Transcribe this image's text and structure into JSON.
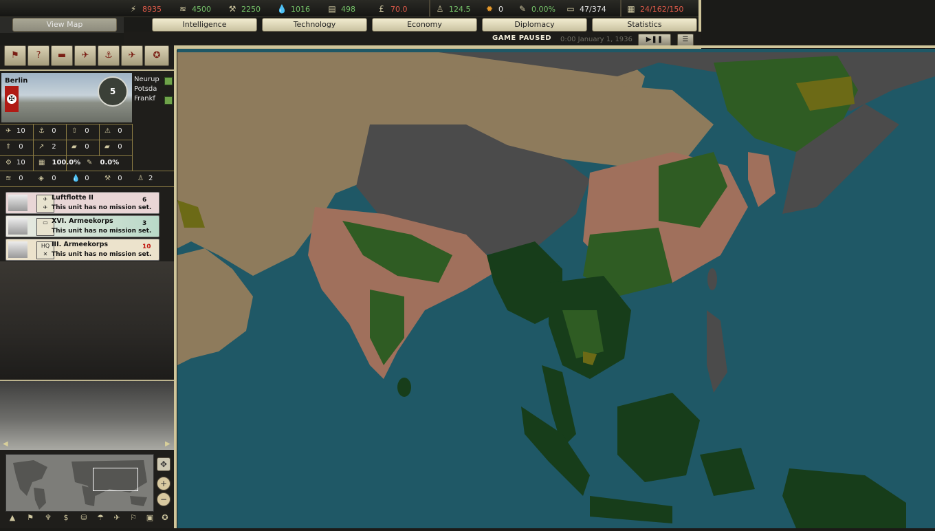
{
  "resources": [
    {
      "icon": "energy-icon",
      "value": "8935",
      "color": "red"
    },
    {
      "icon": "metal-icon",
      "value": "4500",
      "color": "grn"
    },
    {
      "icon": "rare-materials-icon",
      "value": "2250",
      "color": "grn"
    },
    {
      "icon": "oil-icon",
      "value": "1016",
      "color": "grn"
    },
    {
      "icon": "supplies-icon",
      "value": "498",
      "color": "grn"
    },
    {
      "icon": "money-icon",
      "value": "70.0",
      "color": "red"
    },
    {
      "icon": "manpower-icon",
      "value": "124.5",
      "color": "grn"
    },
    {
      "icon": "nuke-icon",
      "value": "0",
      "color": "wht"
    },
    {
      "icon": "dissent-icon",
      "value": "0.00%",
      "color": "grn"
    },
    {
      "icon": "transport-icon",
      "value": "47/374",
      "color": "wht"
    },
    {
      "icon": "convoy-icon",
      "value": "24/162/150",
      "color": "red"
    }
  ],
  "nav": {
    "view_map": "View Map",
    "tabs": [
      "Intelligence",
      "Technology",
      "Economy",
      "Diplomacy",
      "Statistics"
    ]
  },
  "status": {
    "paused": "GAME PAUSED",
    "date": "0:00 January 1, 1936"
  },
  "toolbar_icons": [
    "flag-icon",
    "question-icon",
    "tank-icon",
    "aircraft-icon",
    "anchor-icon",
    "bomber-icon",
    "star-cross-icon",
    "plane-list-icon"
  ],
  "province": {
    "name": "Berlin",
    "victory_points": "5",
    "neighbors": [
      "Neurup",
      "Potsda",
      "Frankf"
    ],
    "stats": [
      {
        "icon": "airfield-icon",
        "value": "10"
      },
      {
        "icon": "naval-base-icon",
        "value": "0"
      },
      {
        "icon": "rocket-icon",
        "value": "0"
      },
      {
        "icon": "radar-icon",
        "value": "0"
      },
      {
        "icon": "nuclear-reactor-icon",
        "value": "0"
      },
      {
        "icon": "aa-gun-icon",
        "value": "2"
      },
      {
        "icon": "fort-icon",
        "value": "0"
      },
      {
        "icon": "coastal-fort-icon",
        "value": "0"
      },
      {
        "icon": "industry-icon",
        "value": "10"
      },
      {
        "icon": "infrastructure-icon",
        "value": "100.0%"
      },
      {
        "icon": "dissent-icon",
        "value": "0.0%"
      }
    ],
    "resources": [
      {
        "icon": "metal-icon",
        "value": "0"
      },
      {
        "icon": "energy-icon",
        "value": "0"
      },
      {
        "icon": "oil-icon",
        "value": "0"
      },
      {
        "icon": "rare-materials-icon",
        "value": "0"
      },
      {
        "icon": "manpower-icon",
        "value": "2"
      }
    ]
  },
  "units": [
    {
      "name": "Luftflotte II",
      "mission": "This unit has no mission set.",
      "count": "6",
      "count_color": "#111111",
      "bg": "#e9d6d6",
      "type": "air"
    },
    {
      "name": "XVI. Armeekorps",
      "mission": "This unit has no mission set.",
      "count": "3",
      "count_color": "#111111",
      "bg": "#cde2d6",
      "type": "armor"
    },
    {
      "name": "III. Armeekorps",
      "mission": "This unit has no mission set.",
      "count": "10",
      "count_color": "#c0180f",
      "bg": "#ece3cc",
      "type": "HQ"
    }
  ],
  "map_colors": {
    "ocean": "#1f5866",
    "ocean_shelf": "#2a6b78",
    "neutral_tan": "#8e7b5c",
    "grey": "#4b4b4b",
    "dark_green": "#173d1a",
    "green": "#2f5c23",
    "salmon": "#a0705c",
    "olive": "#6c6a16"
  }
}
